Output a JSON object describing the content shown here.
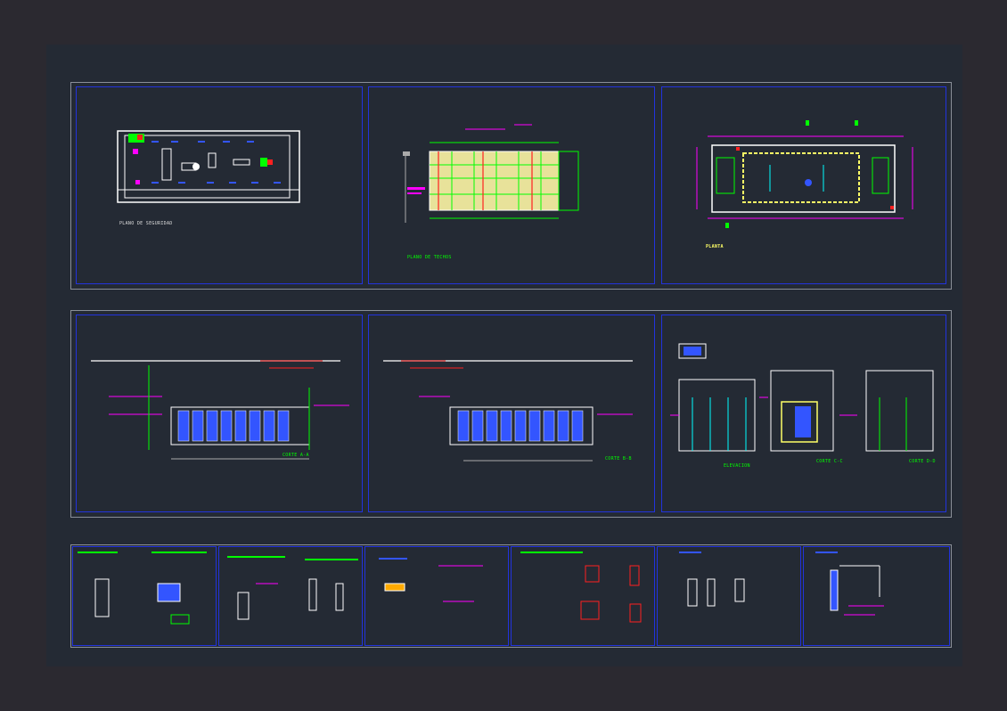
{
  "colors": {
    "background": "#2b2930",
    "sheet": "#242a34",
    "frame": "#8a8f98",
    "inner_border": "#2233dd",
    "magenta": "#ff00ff",
    "green": "#00ff00",
    "yellow": "#ffff66",
    "cyan": "#00ffff",
    "red": "#ff2020",
    "white": "#ffffff",
    "blue": "#3355ff"
  },
  "sheets": {
    "top": {
      "security_plan": {
        "title": "PLANO DE SEGURIDAD"
      },
      "roof_plan": {
        "title": "PLANO DE TECHOS"
      },
      "floor_plan": {
        "title": "PLANTA"
      }
    },
    "middle": {
      "section_aa": {
        "title": "CORTE A-A"
      },
      "section_bb": {
        "title": "CORTE B-B"
      },
      "elevations": {
        "labels": [
          "ELEVACION",
          "CORTE C-C",
          "CORTE D-D"
        ]
      }
    }
  }
}
